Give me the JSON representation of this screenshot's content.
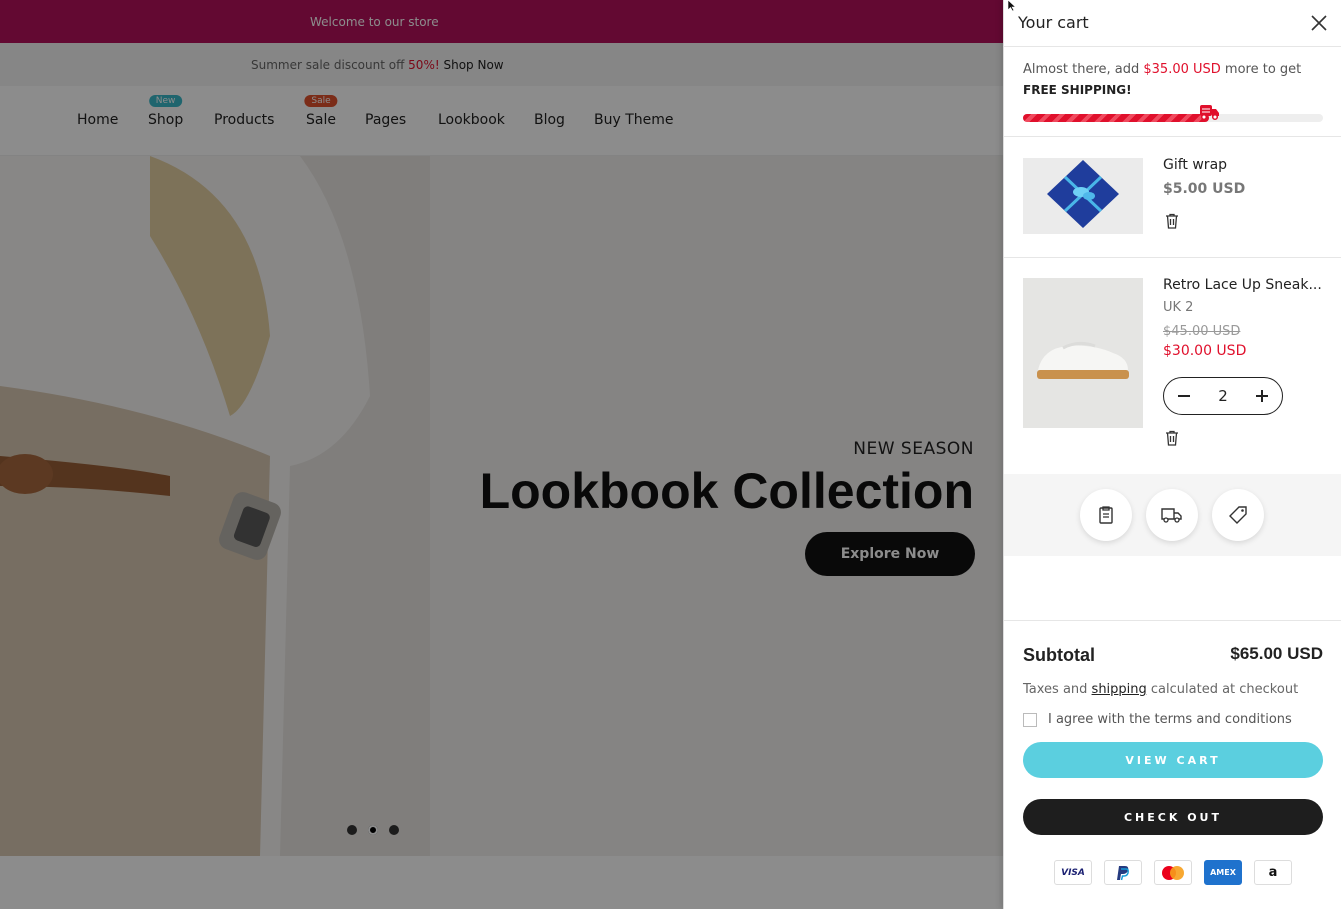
{
  "announcement": {
    "text": "Welcome to our store"
  },
  "promo": {
    "prefix": "Summer sale discount off ",
    "percent": "50%!",
    "link": "Shop Now"
  },
  "nav": {
    "items": [
      {
        "label": "Home",
        "badge": ""
      },
      {
        "label": "Shop",
        "badge": "New"
      },
      {
        "label": "Products",
        "badge": ""
      },
      {
        "label": "Sale",
        "badge": "Sale"
      },
      {
        "label": "Pages",
        "badge": ""
      },
      {
        "label": "Lookbook",
        "badge": ""
      },
      {
        "label": "Blog",
        "badge": ""
      },
      {
        "label": "Buy Theme",
        "badge": ""
      }
    ]
  },
  "hero": {
    "subtitle": "NEW SEASON",
    "title": "Lookbook Collection",
    "button": "Explore Now",
    "slides": 3,
    "active_slide": 2
  },
  "cart": {
    "title": "Your cart",
    "shipping": {
      "prefix": "Almost there, add ",
      "amount": "$35.00 USD",
      "suffix": " more to get",
      "free_label": "FREE SHIPPING!",
      "progress": 0.62
    },
    "items": [
      {
        "name": "Gift wrap",
        "price": "$5.00 USD"
      },
      {
        "name": "Retro Lace Up Sneak...",
        "variant": "UK 2",
        "old_price": "$45.00 USD",
        "price": "$30.00 USD",
        "quantity": "2"
      }
    ],
    "tools": [
      "note-icon",
      "truck-icon",
      "tag-icon"
    ],
    "subtotal_label": "Subtotal",
    "subtotal_value": "$65.00 USD",
    "tax_prefix": "Taxes and ",
    "tax_link": "shipping",
    "tax_suffix": " calculated at checkout",
    "agree_label": "I agree with the terms and conditions",
    "view_cart": "VIEW CART",
    "checkout": "CHECK OUT",
    "payments": [
      "VISA",
      "PayPal",
      "Mastercard",
      "AMEX",
      "Amazon"
    ]
  },
  "colors": {
    "announcement_bg": "#b5125c",
    "accent_red": "#e0102c",
    "view_cart_bg": "#5bcfdf",
    "badge_new": "#3ab8c8",
    "badge_sale": "#e0502c"
  }
}
